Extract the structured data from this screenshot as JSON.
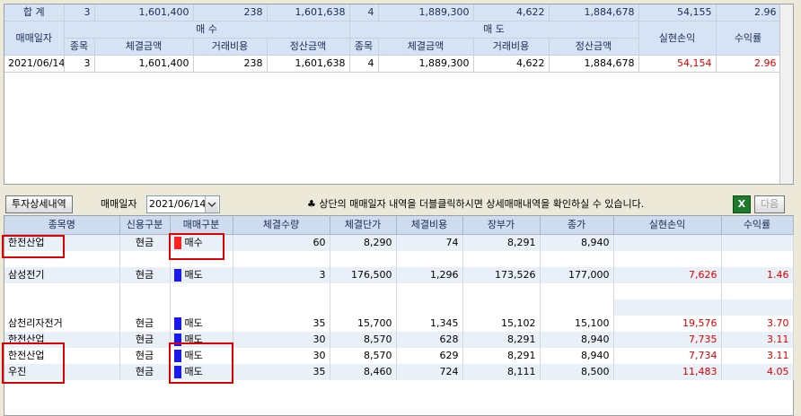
{
  "summary": {
    "total_label": "합 계",
    "buy_count": "3",
    "buy_amount": "1,601,400",
    "buy_fee": "238",
    "buy_settle": "1,601,638",
    "sell_count": "4",
    "sell_amount": "1,889,300",
    "sell_fee": "4,622",
    "sell_settle": "1,884,678",
    "realized": "54,155",
    "return_rate": "2.96"
  },
  "summary_headers": {
    "date": "매매일자",
    "buy": "매 수",
    "sell": "매 도",
    "realized": "실현손익",
    "return_rate": "수익률",
    "count": "종목",
    "amount": "체결금액",
    "fee": "거래비용",
    "settle": "정산금액"
  },
  "summary_rows": [
    {
      "date": "2021/06/14",
      "buy_count": "3",
      "buy_amount": "1,601,400",
      "buy_fee": "238",
      "buy_settle": "1,601,638",
      "sell_count": "4",
      "sell_amount": "1,889,300",
      "sell_fee": "4,622",
      "sell_settle": "1,884,678",
      "realized": "54,154",
      "return_rate": "2.96"
    }
  ],
  "toolbar": {
    "detail_button": "투자상세내역",
    "date_label": "매매일자",
    "date_value": "2021/06/14",
    "notice": "♣ 상단의 매매일자 내역을 더블클릭하시면 상세매매내역을 확인하실 수 있습니다.",
    "next_button": "다음"
  },
  "detail_headers": [
    "종목명",
    "신용구분",
    "매매구분",
    "체결수량",
    "체결단가",
    "체결비용",
    "장부가",
    "종가",
    "실현손익",
    "수익률"
  ],
  "detail_rows": [
    {
      "name": "한전산업",
      "credit": "현금",
      "type": "매수",
      "marker": "red",
      "qty": "60",
      "price": "8,290",
      "fee": "74",
      "book": "8,291",
      "close": "8,940",
      "realized": "",
      "rate": ""
    },
    {
      "name": "삼성전기",
      "credit": "현금",
      "type": "매도",
      "marker": "blue",
      "qty": "3",
      "price": "176,500",
      "fee": "1,296",
      "book": "173,526",
      "close": "177,000",
      "realized": "7,626",
      "rate": "1.46"
    },
    {
      "name": "삼천리자전거",
      "credit": "현금",
      "type": "매도",
      "marker": "blue",
      "qty": "35",
      "price": "15,700",
      "fee": "1,345",
      "book": "15,102",
      "close": "15,100",
      "realized": "19,576",
      "rate": "3.70"
    },
    {
      "name": "한전산업",
      "credit": "현금",
      "type": "매도",
      "marker": "blue",
      "qty": "30",
      "price": "8,570",
      "fee": "628",
      "book": "8,291",
      "close": "8,940",
      "realized": "7,735",
      "rate": "3.11"
    },
    {
      "name": "한전산업",
      "credit": "현금",
      "type": "매도",
      "marker": "blue",
      "qty": "30",
      "price": "8,570",
      "fee": "629",
      "book": "8,291",
      "close": "8,940",
      "realized": "7,734",
      "rate": "3.11"
    },
    {
      "name": "우진",
      "credit": "현금",
      "type": "매도",
      "marker": "blue",
      "qty": "35",
      "price": "8,460",
      "fee": "724",
      "book": "8,111",
      "close": "8,500",
      "realized": "11,483",
      "rate": "4.05"
    }
  ],
  "colors": {
    "header_bg": "#d6e3f5",
    "profit": "#e00000",
    "buy_marker": "#ff2020",
    "sell_marker": "#1a1aee"
  }
}
